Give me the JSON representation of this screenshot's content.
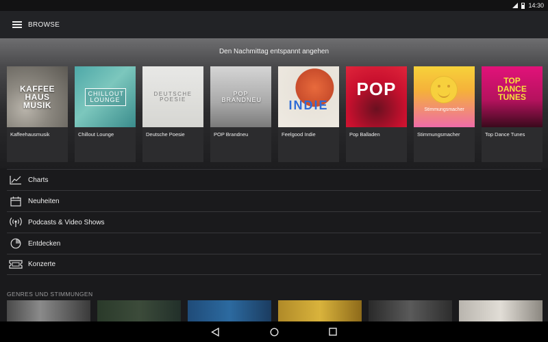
{
  "status_bar": {
    "time": "14:30",
    "icons": [
      "signal-icon",
      "battery-icon"
    ]
  },
  "app_bar": {
    "title": "BROWSE",
    "menu_icon": "hamburger-menu-icon"
  },
  "featured": {
    "title": "Den Nachmittag entspannt angehen",
    "playlists": [
      {
        "label": "Kaffeehausmusik",
        "art_text": "KAFFEE HAUS MUSIK"
      },
      {
        "label": "Chillout Lounge",
        "art_text": "CHILLOUT LOUNGE"
      },
      {
        "label": "Deutsche Poesie",
        "art_text": "DEUTSCHE POESIE"
      },
      {
        "label": "POP Brandneu",
        "art_text": "POP BRANDNEU"
      },
      {
        "label": "Feelgood Indie",
        "art_text": "INDIE"
      },
      {
        "label": "Pop Balladen",
        "art_text": "POP"
      },
      {
        "label": "Stimmungsmacher",
        "art_text": "Stimmungsmacher"
      },
      {
        "label": "Top Dance Tunes",
        "art_text": "TOP DANCE TUNES"
      }
    ]
  },
  "menu": {
    "items": [
      {
        "label": "Charts",
        "icon": "chart-icon"
      },
      {
        "label": "Neuheiten",
        "icon": "calendar-icon"
      },
      {
        "label": "Podcasts & Video Shows",
        "icon": "broadcast-icon"
      },
      {
        "label": "Entdecken",
        "icon": "compass-icon"
      },
      {
        "label": "Konzerte",
        "icon": "ticket-icon"
      }
    ]
  },
  "genres": {
    "title": "GENRES UND STIMMUNGEN"
  },
  "nav_bar": {
    "icons": [
      "back-icon",
      "home-icon",
      "recents-icon"
    ]
  }
}
